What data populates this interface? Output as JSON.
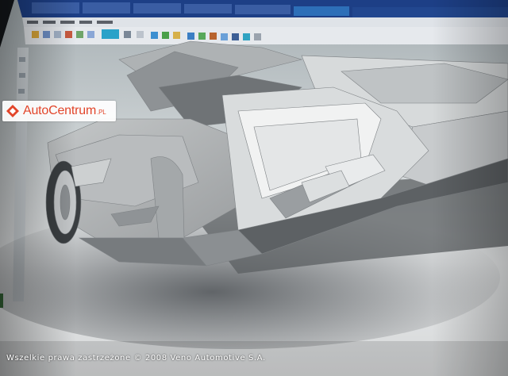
{
  "watermark": {
    "brand_main": "AutoCentrum",
    "brand_suffix": ".PL",
    "logo_color": "#e2452a"
  },
  "caption": {
    "copyright": "Wszelkie prawa zastrzeżone © 2008 Veno Automotive S.A."
  },
  "scene": {
    "subject": "car-cad-model-render",
    "screen_background": "#e8eaeb",
    "taskbar_color": "#1d3f86",
    "active_tab_color": "#2d6fb8"
  }
}
